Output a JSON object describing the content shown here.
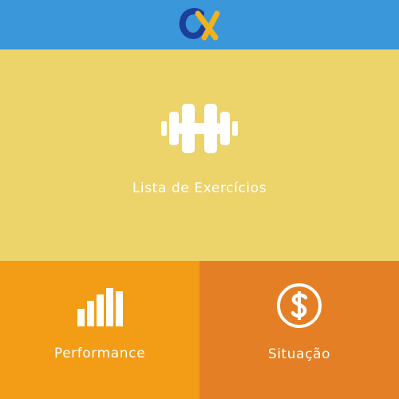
{
  "header": {
    "logo_icon": "ox-logo-icon",
    "background": "#3a97d9"
  },
  "tiles": [
    {
      "label": "Lista de Exercícios",
      "icon": "dumbbell-icon",
      "color": "#ecd36a"
    },
    {
      "label": "Performance",
      "icon": "bar-chart-icon",
      "color": "#f39c16"
    },
    {
      "label": "Situação",
      "icon": "dollar-circle-icon",
      "color": "#e47f25"
    }
  ]
}
